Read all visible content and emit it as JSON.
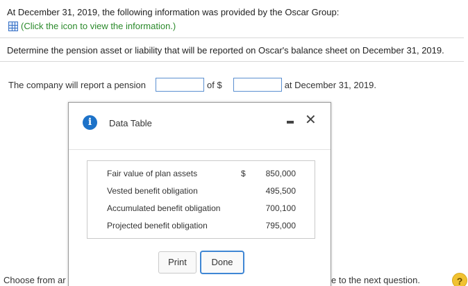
{
  "intro": "At December 31, 2019, the following information was provided by the Oscar Group:",
  "info_link": {
    "icon": "table-grid-icon",
    "text": "(Click the icon to view the information.)"
  },
  "question": "Determine the pension asset or liability that will be reported on Oscar's balance sheet on December 31, 2019.",
  "answer": {
    "prefix": "The company will report a pension",
    "middle": "of $",
    "suffix": "at December 31, 2019.",
    "input1_value": "",
    "input2_value": ""
  },
  "footer": {
    "left": "Choose from ar",
    "right": "e to the next question."
  },
  "help_label": "?",
  "modal": {
    "icon_text": "i",
    "title": "Data Table",
    "minimize_icon": "minimize-icon",
    "close_label": "✕",
    "rows": [
      {
        "label": "Fair value of plan assets",
        "dollar": "$",
        "value": "850,000"
      },
      {
        "label": "Vested benefit obligation",
        "dollar": "",
        "value": "495,500"
      },
      {
        "label": "Accumulated benefit obligation",
        "dollar": "",
        "value": "700,100"
      },
      {
        "label": "Projected benefit obligation",
        "dollar": "",
        "value": "795,000"
      }
    ],
    "print_label": "Print",
    "done_label": "Done"
  },
  "colors": {
    "link_green": "#2b8a2b",
    "input_border": "#5a8fd0",
    "done_border": "#3f86d4",
    "info_blue": "#1d72c8",
    "help_yellow": "#f1c232"
  }
}
